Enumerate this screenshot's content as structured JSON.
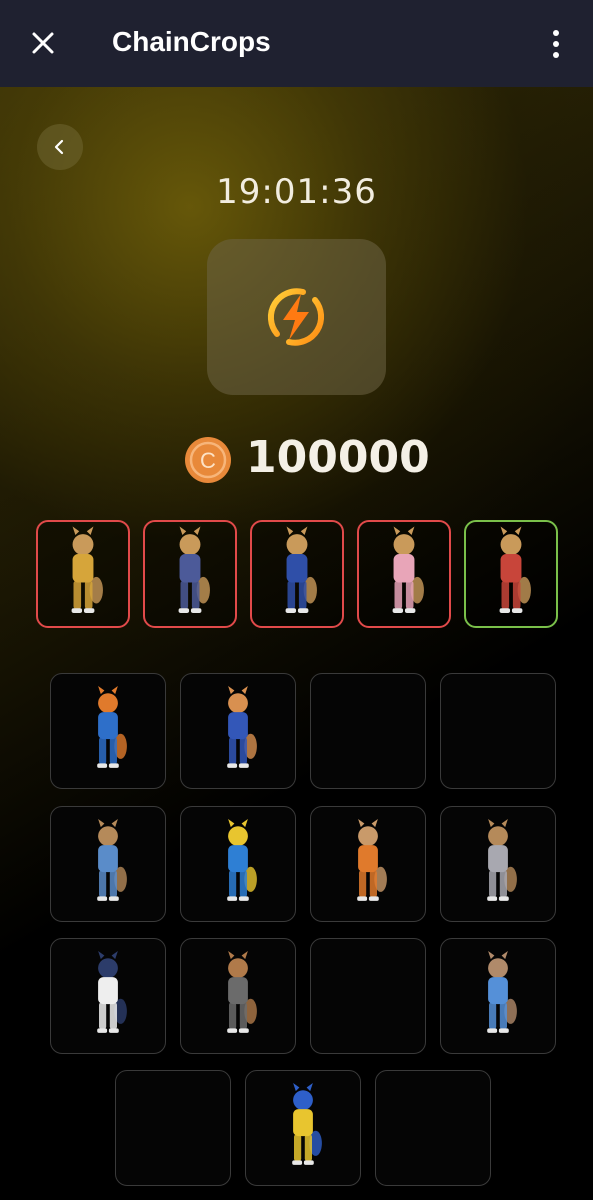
{
  "header": {
    "title": "ChainCrops",
    "close_icon": "close-icon",
    "more_icon": "more-vertical-icon"
  },
  "back_icon": "chevron-left-icon",
  "timer": "19:01:36",
  "energy_icon": "lightning-bolt-icon",
  "balance": {
    "coin_icon": "coin-icon",
    "coin_letter": "C",
    "amount": "100000"
  },
  "characters": [
    {
      "name": "fox-yellow",
      "color": "#d6a53a",
      "state": "locked"
    },
    {
      "name": "squirrel-blue",
      "color": "#4c5a99",
      "state": "locked"
    },
    {
      "name": "rabbit-blue",
      "color": "#2f4fa8",
      "state": "locked"
    },
    {
      "name": "fox-pink",
      "color": "#e8a5b8",
      "state": "locked"
    },
    {
      "name": "hamster-red",
      "color": "#c8453a",
      "state": "active"
    }
  ],
  "slots": [
    {
      "filled": true,
      "color": "#2e6fc9",
      "accent": "#e07a2c"
    },
    {
      "filled": true,
      "color": "#3357b8",
      "accent": "#d89050"
    },
    {
      "filled": false
    },
    {
      "filled": false
    },
    {
      "filled": true,
      "color": "#5a8cc9",
      "accent": "#b58a5a"
    },
    {
      "filled": true,
      "color": "#2e7fd4",
      "accent": "#e8c52f"
    },
    {
      "filled": true,
      "color": "#e07a2c",
      "accent": "#c99a6a"
    },
    {
      "filled": true,
      "color": "#a8a8b0",
      "accent": "#b58a5a"
    },
    {
      "filled": true,
      "color": "#eeeeee",
      "accent": "#2c3c6a"
    },
    {
      "filled": true,
      "color": "#6b6b6b",
      "accent": "#b07a4a"
    },
    {
      "filled": false
    },
    {
      "filled": true,
      "color": "#5590d8",
      "accent": "#b08a6a"
    },
    {
      "filled": false
    },
    {
      "filled": true,
      "color": "#e8c52f",
      "accent": "#2e5fc9"
    },
    {
      "filled": false
    }
  ]
}
